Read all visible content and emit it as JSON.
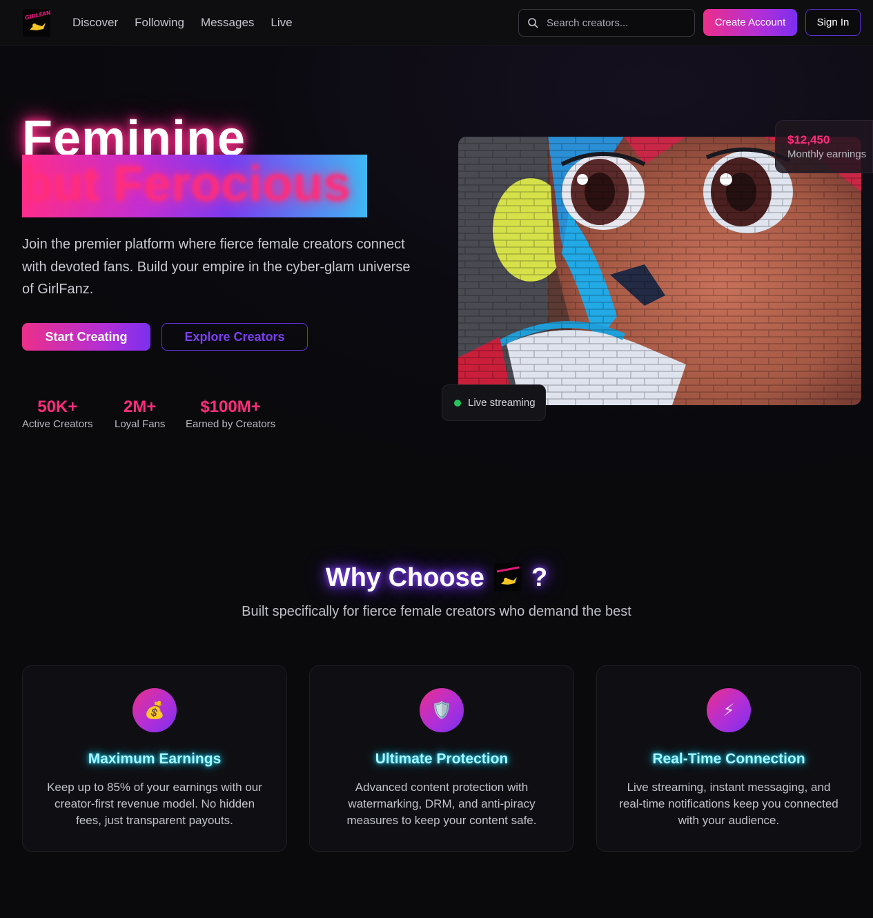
{
  "nav": {
    "logo_text": "GIRLFANZ",
    "links": [
      "Discover",
      "Following",
      "Messages",
      "Live"
    ],
    "search_placeholder": "Search creators...",
    "create_account": "Create Account",
    "sign_in": "Sign In"
  },
  "hero": {
    "title_line1": "Feminine",
    "title_line2": "but Ferocious",
    "description": "Join the premier platform where fierce female creators connect with devoted fans. Build your empire in the cyber-glam universe of GirlFanz.",
    "primary_cta": "Start Creating",
    "secondary_cta": "Explore Creators",
    "stats": [
      {
        "value": "50K+",
        "label": "Active Creators"
      },
      {
        "value": "2M+",
        "label": "Loyal Fans"
      },
      {
        "value": "$100M+",
        "label": "Earned by Creators"
      }
    ],
    "earnings_card": {
      "amount": "$12,450",
      "label": "Monthly earnings"
    },
    "live_card": {
      "label": "Live streaming"
    }
  },
  "why": {
    "title_prefix": "Why Choose",
    "title_suffix": "?",
    "subtitle": "Built specifically for fierce female creators who demand the best",
    "features": [
      {
        "icon": "💰",
        "icon_name": "money-bag-icon",
        "title": "Maximum Earnings",
        "description": "Keep up to 85% of your earnings with our creator-first revenue model. No hidden fees, just transparent payouts."
      },
      {
        "icon": "🛡️",
        "icon_name": "shield-icon",
        "title": "Ultimate Protection",
        "description": "Advanced content protection with watermarking, DRM, and anti-piracy measures to keep your content safe."
      },
      {
        "icon": "⚡",
        "icon_name": "lightning-icon",
        "title": "Real-Time Connection",
        "description": "Live streaming, instant messaging, and real-time notifications keep you connected with your audience."
      }
    ]
  },
  "colors": {
    "background": "#0a0a0d",
    "accent_pink": "#ff2d7a",
    "accent_purple": "#7b3ff2",
    "accent_cyan": "#19d3f0",
    "live_green": "#22c55e"
  }
}
